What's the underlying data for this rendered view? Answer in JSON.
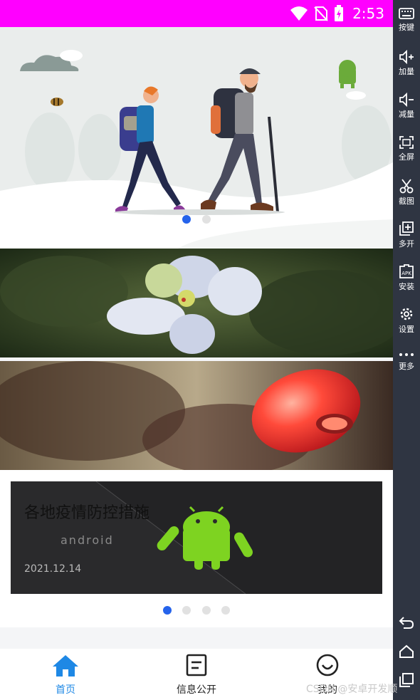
{
  "status_bar": {
    "time": "2:53",
    "background": "#ff00ff"
  },
  "side_toolbar": {
    "items": [
      {
        "icon": "keyboard-icon",
        "label": "按键"
      },
      {
        "icon": "volume-up-icon",
        "label": "加量"
      },
      {
        "icon": "volume-down-icon",
        "label": "减量"
      },
      {
        "icon": "fullscreen-icon",
        "label": "全屏"
      },
      {
        "icon": "scissors-icon",
        "label": "截图"
      },
      {
        "icon": "multi-window-icon",
        "label": "多开"
      },
      {
        "icon": "apk-icon",
        "label": "安装"
      },
      {
        "icon": "gear-icon",
        "label": "设置"
      },
      {
        "icon": "more-dots-icon",
        "label": "更多"
      }
    ],
    "nav": [
      "back-icon",
      "home-icon",
      "recents-icon"
    ]
  },
  "hero_banner": {
    "indicator_count": 2,
    "active_index": 0
  },
  "news_card": {
    "title": "各地疫情防控措施",
    "date": "2021.12.14",
    "logo_text": "android",
    "indicator_count": 4,
    "active_index": 0
  },
  "bottom_nav": {
    "items": [
      {
        "label": "首页",
        "icon": "home-icon",
        "active": true
      },
      {
        "label": "信息公开",
        "icon": "document-icon",
        "active": false
      },
      {
        "label": "我的",
        "icon": "smiley-icon",
        "active": false
      }
    ],
    "active_color": "#1e88e5"
  },
  "watermark": "CSDN @安卓开发顺"
}
